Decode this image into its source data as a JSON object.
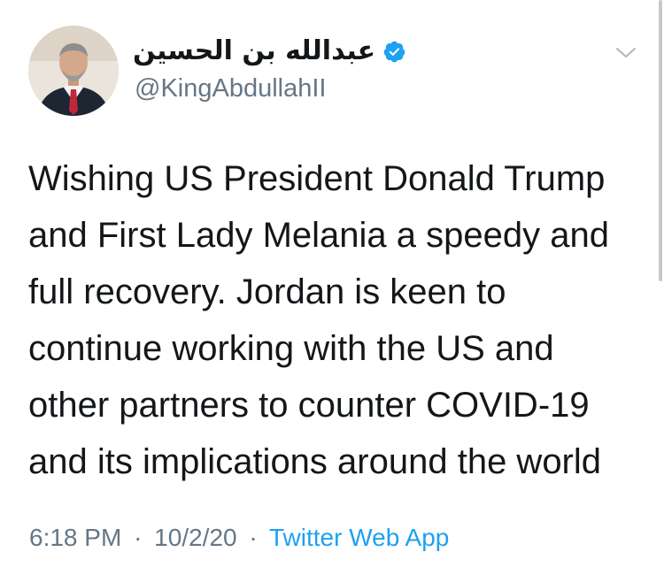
{
  "tweet": {
    "author": {
      "display_name": "عبدالله بن الحسين",
      "handle": "@KingAbdullahII",
      "verified": true,
      "avatar_icon": "profile-photo"
    },
    "text_lines": [
      "Wishing US President Donald Trump",
      "and First Lady Melania a speedy and",
      "full recovery. Jordan is keen to",
      "continue working with the US and",
      "other partners to counter COVID-19",
      "and its implications around the world"
    ],
    "time": "6:18 PM",
    "separator": "·",
    "date": "10/2/20",
    "source": "Twitter Web App"
  },
  "colors": {
    "text": "#14171a",
    "secondary": "#657786",
    "link": "#1da1f2",
    "verified_badge": "#1da1f2"
  },
  "icons": {
    "caret": "chevron-down-icon",
    "verified": "verified-badge-icon"
  }
}
